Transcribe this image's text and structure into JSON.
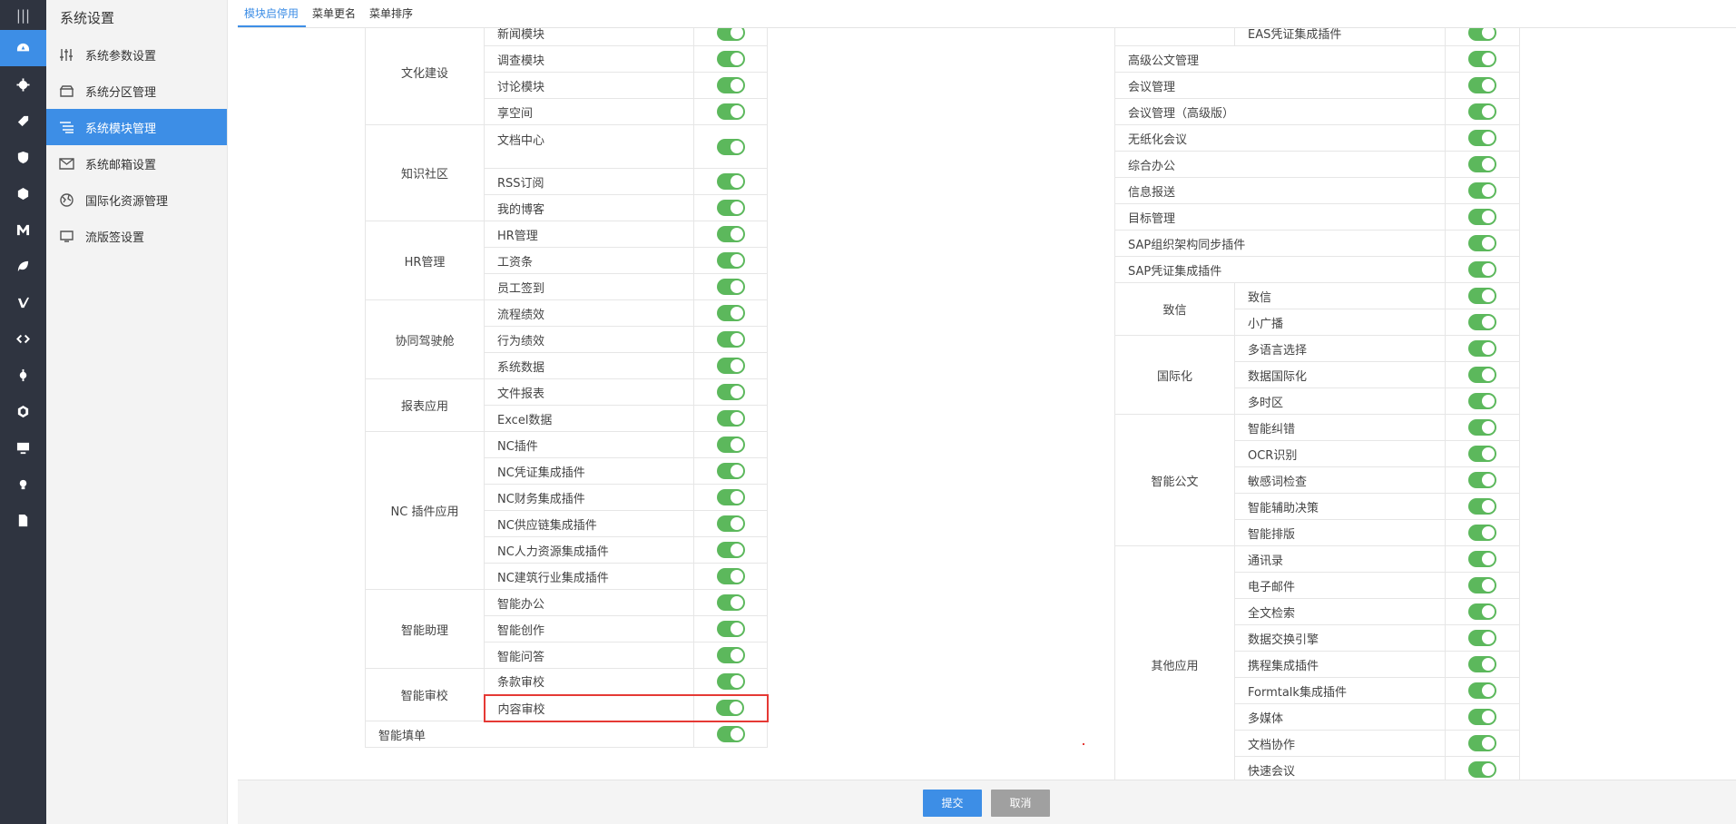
{
  "rail": {
    "items": [
      {
        "icon": "dashboard-icon",
        "active": true
      },
      {
        "icon": "gear-icon"
      },
      {
        "icon": "tag-icon"
      },
      {
        "icon": "shield-icon"
      },
      {
        "icon": "hexagon-icon"
      },
      {
        "icon": "m-letter-icon"
      },
      {
        "icon": "leaf-icon"
      },
      {
        "icon": "v-letter-icon"
      },
      {
        "icon": "code-icon"
      },
      {
        "icon": "cog-icon"
      },
      {
        "icon": "cube-icon"
      },
      {
        "icon": "monitor-icon"
      },
      {
        "icon": "bulb-icon"
      },
      {
        "icon": "document-icon"
      }
    ]
  },
  "menu": {
    "title": "系统设置",
    "items": [
      {
        "label": "系统参数设置",
        "icon": "sliders-icon"
      },
      {
        "label": "系统分区管理",
        "icon": "partition-icon"
      },
      {
        "label": "系统模块管理",
        "icon": "modules-icon",
        "active": true
      },
      {
        "label": "系统邮箱设置",
        "icon": "mail-icon"
      },
      {
        "label": "国际化资源管理",
        "icon": "globe-icon"
      },
      {
        "label": "流版签设置",
        "icon": "monitor-icon"
      }
    ]
  },
  "tabs": [
    {
      "label": "模块启停用",
      "active": true
    },
    {
      "label": "菜单更名"
    },
    {
      "label": "菜单排序"
    }
  ],
  "left_table": [
    {
      "category": "文化建设",
      "modules": [
        "新闻模块",
        "调查模块",
        "讨论模块",
        "享空间"
      ]
    },
    {
      "category": "知识社区",
      "modules": [
        "文档中心",
        "RSS订阅",
        "我的博客"
      ]
    },
    {
      "category": "HR管理",
      "modules": [
        "HR管理",
        "工资条",
        "员工签到"
      ]
    },
    {
      "category": "协同驾驶舱",
      "modules": [
        "流程绩效",
        "行为绩效",
        "系统数据"
      ]
    },
    {
      "category": "报表应用",
      "modules": [
        "文件报表",
        "Excel数据"
      ]
    },
    {
      "category": "NC 插件应用",
      "modules": [
        "NC插件",
        "NC凭证集成插件",
        "NC财务集成插件",
        "NC供应链集成插件",
        "NC人力资源集成插件",
        "NC建筑行业集成插件"
      ]
    },
    {
      "category": "智能助理",
      "modules": [
        "智能办公",
        "智能创作",
        "智能问答"
      ]
    },
    {
      "category": "智能审校",
      "modules": [
        "条款审校",
        "内容审校"
      ]
    },
    {
      "single": "智能填单"
    }
  ],
  "right_table": [
    {
      "top_partial": "EAS凭证集成插件"
    },
    {
      "single": "高级公文管理"
    },
    {
      "single": "会议管理"
    },
    {
      "single": "会议管理（高级版）"
    },
    {
      "single": "无纸化会议"
    },
    {
      "single": "综合办公"
    },
    {
      "single": "信息报送"
    },
    {
      "single": "目标管理"
    },
    {
      "single": "SAP组织架构同步插件"
    },
    {
      "single": "SAP凭证集成插件"
    },
    {
      "category": "致信",
      "modules": [
        "致信",
        "小广播"
      ]
    },
    {
      "category": "国际化",
      "modules": [
        "多语言选择",
        "数据国际化",
        "多时区"
      ]
    },
    {
      "category": "智能公文",
      "modules": [
        "智能纠错",
        "OCR识别",
        "敏感词检查",
        "智能辅助决策",
        "智能排版"
      ]
    },
    {
      "category": "其他应用",
      "modules": [
        "通讯录",
        "电子邮件",
        "全文检索",
        "数据交换引擎",
        "携程集成插件",
        "Formtalk集成插件",
        "多媒体",
        "文档协作",
        "快速会议"
      ]
    }
  ],
  "footer": {
    "submit": "提交",
    "cancel": "取消"
  },
  "colors": {
    "accent": "#3d8ee6",
    "toggle_on": "#5cb85c",
    "highlight": "#e53935"
  }
}
